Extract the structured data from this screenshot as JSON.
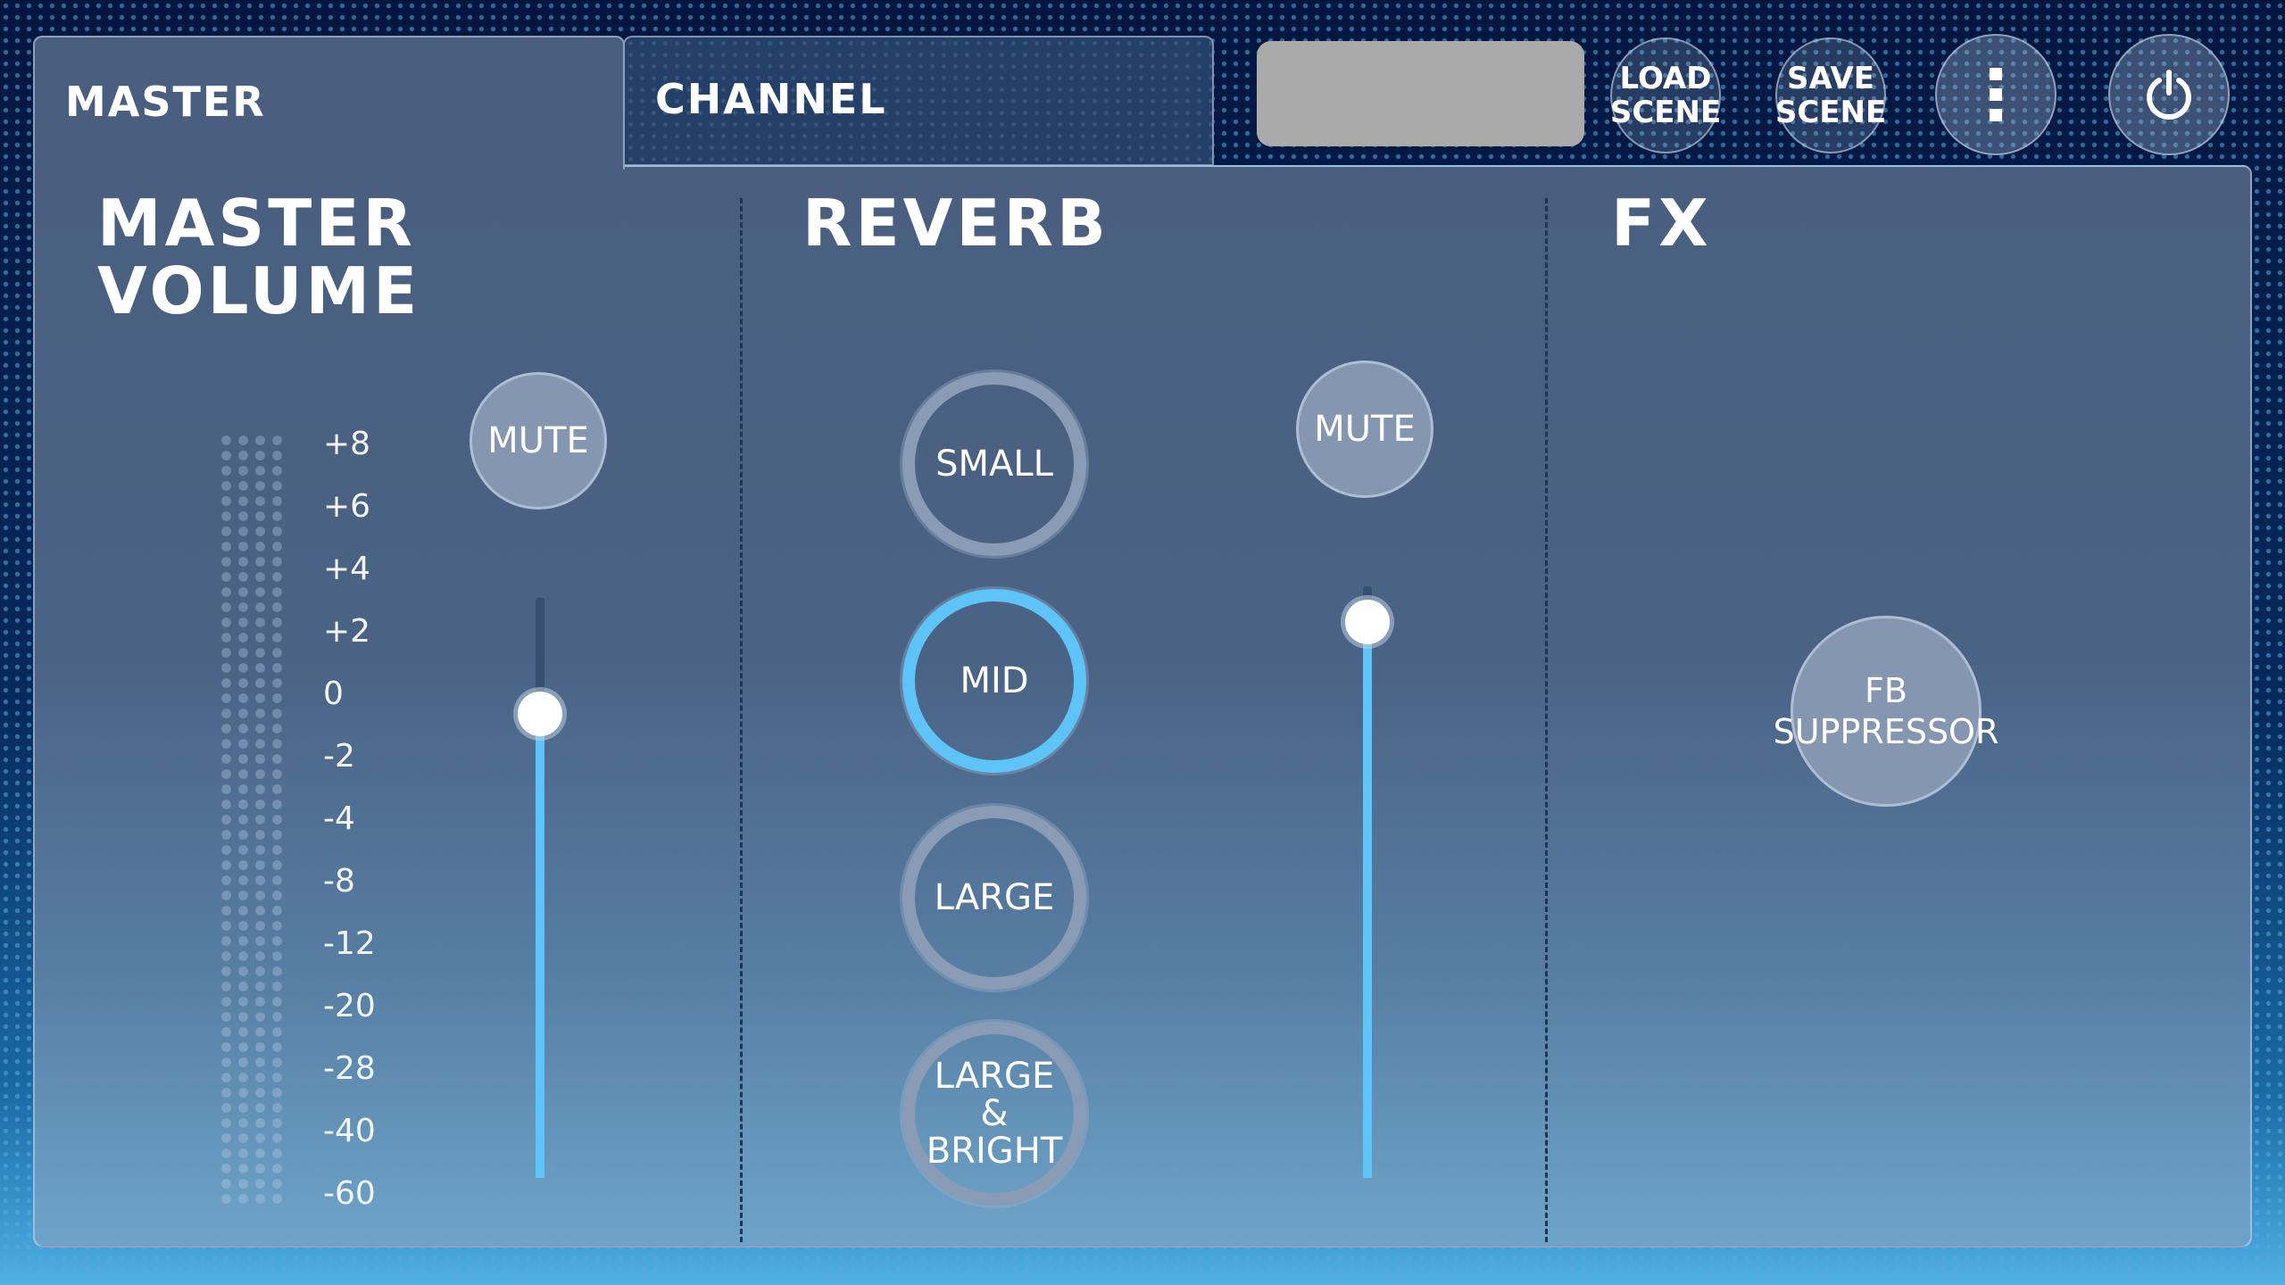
{
  "tabs": [
    {
      "label": "MASTER",
      "active": true
    },
    {
      "label": "CHANNEL",
      "active": false
    }
  ],
  "header": {
    "scene_name_display": "",
    "load_scene": [
      "LOAD",
      "SCENE"
    ],
    "save_scene": [
      "SAVE",
      "SCENE"
    ],
    "menu_icon": "vertical-ellipsis",
    "power_icon": "power"
  },
  "master": {
    "title": [
      "MASTER",
      "VOLUME"
    ],
    "mute_label": "MUTE",
    "scale": [
      "+8",
      "+6",
      "+4",
      "+2",
      "0",
      "-2",
      "-4",
      "-8",
      "-12",
      "-20",
      "-28",
      "-40",
      "-60"
    ],
    "fader_level": 0.8
  },
  "reverb": {
    "title": "REVERB",
    "options": [
      {
        "label": [
          "SMALL"
        ],
        "selected": false
      },
      {
        "label": [
          "MID"
        ],
        "selected": true
      },
      {
        "label": [
          "LARGE"
        ],
        "selected": false
      },
      {
        "label": [
          "LARGE &",
          "BRIGHT"
        ],
        "selected": false
      }
    ],
    "mute_label": "MUTE",
    "fader_level": 0.94
  },
  "fx": {
    "title": "FX",
    "fb_suppressor": [
      "FB",
      "SUPPRESSOR"
    ]
  },
  "colors": {
    "accent": "#5ec4f7",
    "panel": "#4a5f80",
    "background": "#05204f"
  }
}
